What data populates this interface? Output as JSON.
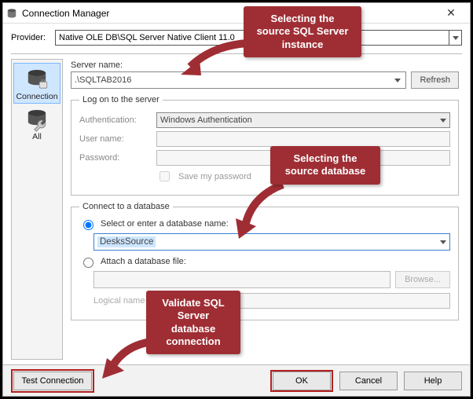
{
  "window": {
    "title": "Connection Manager",
    "close_glyph": "✕"
  },
  "provider": {
    "label": "Provider:",
    "value": "Native OLE DB\\SQL Server Native Client 11.0"
  },
  "sidebar": {
    "items": [
      {
        "label": "Connection",
        "selected": true
      },
      {
        "label": "All",
        "selected": false
      }
    ]
  },
  "server": {
    "label": "Server name:",
    "value": ".\\SQLTAB2016",
    "refresh": "Refresh"
  },
  "logon": {
    "legend": "Log on to the server",
    "auth_label": "Authentication:",
    "auth_value": "Windows Authentication",
    "user_label": "User name:",
    "user_value": "",
    "pass_label": "Password:",
    "pass_value": "",
    "save_pw": "Save my password"
  },
  "db": {
    "legend": "Connect to a database",
    "opt_select": "Select or enter a database name:",
    "name_value": "DesksSource",
    "opt_attach": "Attach a database file:",
    "file_value": "",
    "browse": "Browse...",
    "logical_label": "Logical name",
    "logical_value": ""
  },
  "footer": {
    "test": "Test Connection",
    "ok": "OK",
    "cancel": "Cancel",
    "help": "Help"
  },
  "callouts": {
    "c1": "Selecting the source SQL Server instance",
    "c2": "Selecting the source database",
    "c3": "Validate SQL Server database connection"
  }
}
